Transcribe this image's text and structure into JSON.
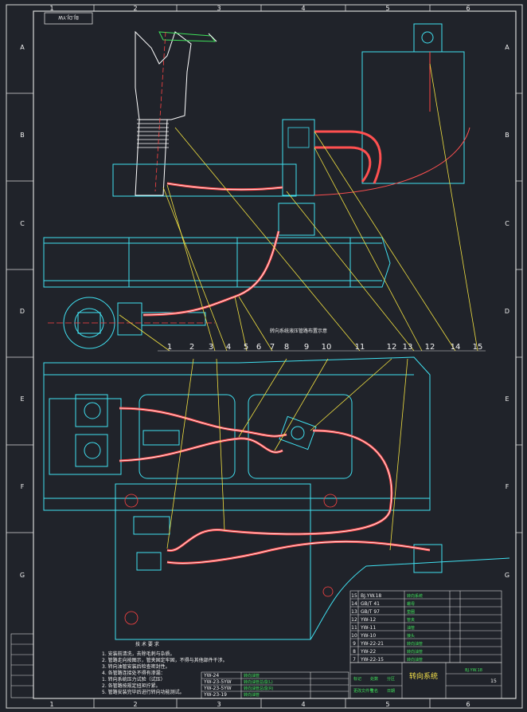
{
  "drawing": {
    "stamp_text": "BJ.DJ.YW",
    "column_labels": [
      "1",
      "2",
      "3",
      "4",
      "5",
      "6"
    ],
    "row_labels": [
      "A",
      "B",
      "C",
      "D",
      "E",
      "F",
      "G"
    ],
    "callouts": [
      "1",
      "2",
      "3",
      "4",
      "5",
      "6",
      "7",
      "8",
      "9",
      "10",
      "11",
      "12",
      "13",
      "12",
      "14",
      "15"
    ],
    "mid_caption": "转向系统液压管路布置示意",
    "notes_title": "技 术 要 求",
    "notes": [
      "1. 安装前清洗，去除毛刺与杂质。",
      "2. 管路走向按图示，管夹固定牢固，不得与其他部件干涉。",
      "3. 转向油管安装后检查密封性。",
      "4. 各管路连接处不得有渗漏：",
      "   1. 转向系统压力试验（试压）",
      "   2. 各管路按规定扭矩拧紧。",
      "5. 管路安装完毕后进行转向功能测试。"
    ],
    "title_block": {
      "name": "转向系统",
      "code": "BJ.YW.18",
      "sheet": "15"
    },
    "parts_list": [
      {
        "no": "15",
        "code": "BJ.YW.18",
        "name": "转向系统"
      },
      {
        "no": "14",
        "code": "GB/T 41",
        "name": "螺母"
      },
      {
        "no": "13",
        "code": "GB/T 97",
        "name": "垫圈"
      },
      {
        "no": "12",
        "code": "YW-12",
        "name": "管夹"
      },
      {
        "no": "11",
        "code": "YW-11",
        "name": "油管"
      },
      {
        "no": "10",
        "code": "YW-10",
        "name": "接头"
      },
      {
        "no": "9",
        "code": "YW-22-21",
        "name": "转向油管"
      },
      {
        "no": "8",
        "code": "YW-22",
        "name": "转向油管"
      },
      {
        "no": "7",
        "code": "YW-22-15",
        "name": "转向油管"
      }
    ],
    "lower_list": [
      {
        "code": "YW-24",
        "name": "转向油管"
      },
      {
        "code": "YW-23-5YW",
        "name": "转向油管总成(L)"
      },
      {
        "code": "YW-23-5YW",
        "name": "转向油管总成(R)"
      },
      {
        "code": "YW-23-19",
        "name": "转向油管"
      }
    ],
    "revision_labels": [
      "标记",
      "处数",
      "分区",
      "更改文件号",
      "签名",
      "日期"
    ]
  }
}
